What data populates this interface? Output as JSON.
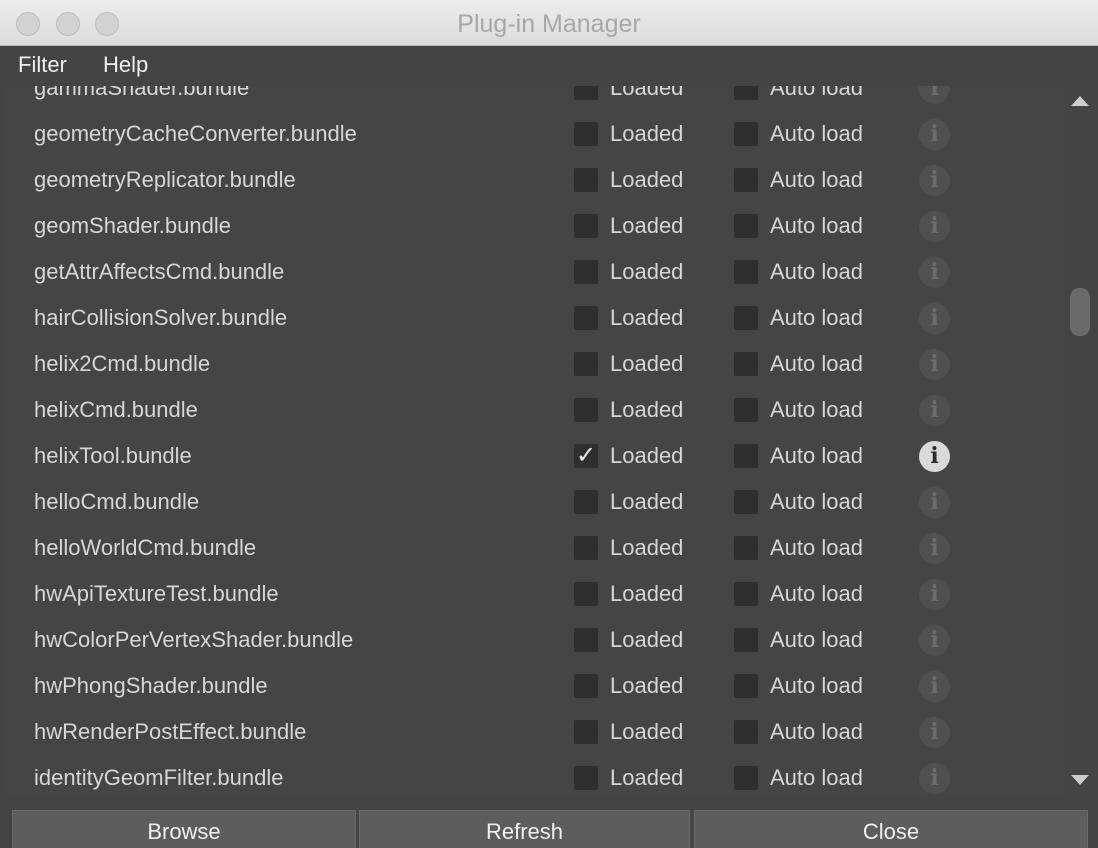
{
  "window": {
    "title": "Plug-in Manager"
  },
  "menu": {
    "filter": "Filter",
    "help": "Help"
  },
  "labels": {
    "loaded": "Loaded",
    "auto_load": "Auto load"
  },
  "plugins": [
    {
      "name": "gammaShader.bundle",
      "loaded": false,
      "auto_load": false,
      "info_active": false
    },
    {
      "name": "geometryCacheConverter.bundle",
      "loaded": false,
      "auto_load": false,
      "info_active": false
    },
    {
      "name": "geometryReplicator.bundle",
      "loaded": false,
      "auto_load": false,
      "info_active": false
    },
    {
      "name": "geomShader.bundle",
      "loaded": false,
      "auto_load": false,
      "info_active": false
    },
    {
      "name": "getAttrAffectsCmd.bundle",
      "loaded": false,
      "auto_load": false,
      "info_active": false
    },
    {
      "name": "hairCollisionSolver.bundle",
      "loaded": false,
      "auto_load": false,
      "info_active": false
    },
    {
      "name": "helix2Cmd.bundle",
      "loaded": false,
      "auto_load": false,
      "info_active": false
    },
    {
      "name": "helixCmd.bundle",
      "loaded": false,
      "auto_load": false,
      "info_active": false
    },
    {
      "name": "helixTool.bundle",
      "loaded": true,
      "auto_load": false,
      "info_active": true
    },
    {
      "name": "helloCmd.bundle",
      "loaded": false,
      "auto_load": false,
      "info_active": false
    },
    {
      "name": "helloWorldCmd.bundle",
      "loaded": false,
      "auto_load": false,
      "info_active": false
    },
    {
      "name": "hwApiTextureTest.bundle",
      "loaded": false,
      "auto_load": false,
      "info_active": false
    },
    {
      "name": "hwColorPerVertexShader.bundle",
      "loaded": false,
      "auto_load": false,
      "info_active": false
    },
    {
      "name": "hwPhongShader.bundle",
      "loaded": false,
      "auto_load": false,
      "info_active": false
    },
    {
      "name": "hwRenderPostEffect.bundle",
      "loaded": false,
      "auto_load": false,
      "info_active": false
    },
    {
      "name": "identityGeomFilter.bundle",
      "loaded": false,
      "auto_load": false,
      "info_active": false
    }
  ],
  "buttons": {
    "browse": "Browse",
    "refresh": "Refresh",
    "close": "Close"
  },
  "icons": {
    "info": "info-icon",
    "check": "checkmark-icon",
    "scroll_up": "triangle-up-icon",
    "scroll_down": "triangle-down-icon"
  },
  "scroll": {
    "position_fraction": 0.29
  },
  "colors": {
    "background": "#444444",
    "text": "#d6d6d6",
    "checkbox": "#2f2f2f",
    "titlebar": "#e4e4e4"
  }
}
